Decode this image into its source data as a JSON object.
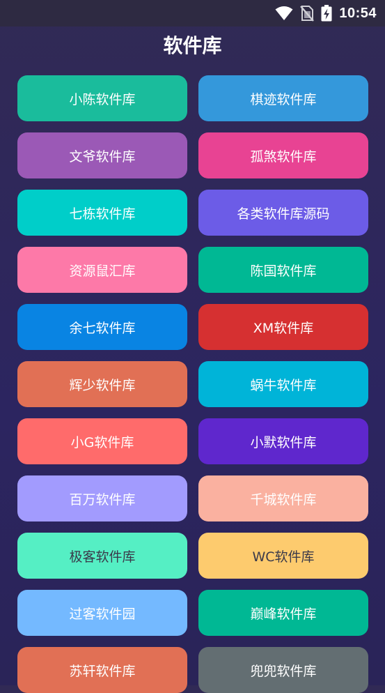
{
  "status_bar": {
    "time": "10:54",
    "icons": [
      "wifi-icon",
      "no-sim-icon",
      "battery-charging-icon"
    ]
  },
  "header": {
    "title": "软件库"
  },
  "libraries": [
    {
      "label": "小陈软件库",
      "color": "#1abc9c",
      "text_color": "#ffffff"
    },
    {
      "label": "棋迹软件库",
      "color": "#3498db",
      "text_color": "#ffffff"
    },
    {
      "label": "文爷软件库",
      "color": "#9b59b6",
      "text_color": "#ffffff"
    },
    {
      "label": "孤煞软件库",
      "color": "#e84393",
      "text_color": "#ffffff"
    },
    {
      "label": "七栋软件库",
      "color": "#00cec9",
      "text_color": "#ffffff"
    },
    {
      "label": "各类软件库源码",
      "color": "#6c5ce7",
      "text_color": "#ffffff"
    },
    {
      "label": "资源鼠汇库",
      "color": "#fd79a8",
      "text_color": "#ffffff"
    },
    {
      "label": "陈国软件库",
      "color": "#00b894",
      "text_color": "#ffffff"
    },
    {
      "label": "余七软件库",
      "color": "#0984e3",
      "text_color": "#ffffff"
    },
    {
      "label": "XM软件库",
      "color": "#d63031",
      "text_color": "#ffffff"
    },
    {
      "label": "辉少软件库",
      "color": "#e17055",
      "text_color": "#ffffff"
    },
    {
      "label": "蜗牛软件库",
      "color": "#00b4d8",
      "text_color": "#ffffff"
    },
    {
      "label": "小G软件库",
      "color": "#ff6b6b",
      "text_color": "#ffffff"
    },
    {
      "label": "小默软件库",
      "color": "#5f27cd",
      "text_color": "#ffffff"
    },
    {
      "label": "百万软件库",
      "color": "#a29bfe",
      "text_color": "#ffffff"
    },
    {
      "label": "千城软件库",
      "color": "#fab1a0",
      "text_color": "#ffffff"
    },
    {
      "label": "极客软件库",
      "color": "#55efc4",
      "text_color": "#3a3a4a"
    },
    {
      "label": "WC软件库",
      "color": "#fdcb6e",
      "text_color": "#3a3a4a"
    },
    {
      "label": "过客软件园",
      "color": "#74b9ff",
      "text_color": "#ffffff"
    },
    {
      "label": "巅峰软件库",
      "color": "#00b894",
      "text_color": "#ffffff"
    },
    {
      "label": "苏轩软件库",
      "color": "#e17055",
      "text_color": "#ffffff"
    },
    {
      "label": "兜兜软件库",
      "color": "#636e72",
      "text_color": "#ffffff"
    }
  ]
}
